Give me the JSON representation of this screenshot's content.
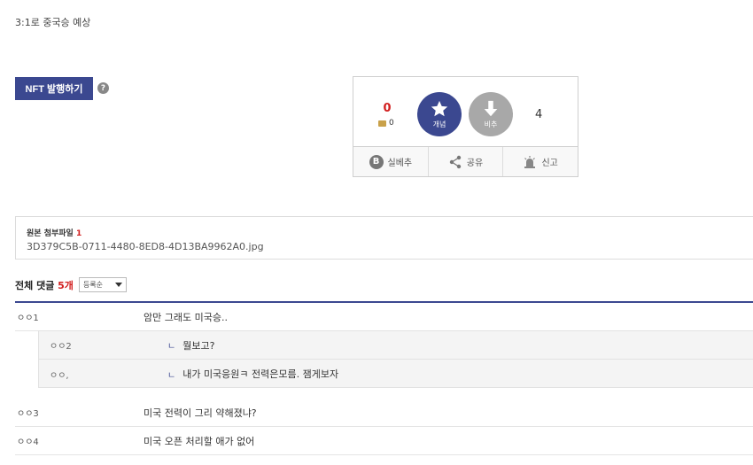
{
  "post": {
    "body_text": "3:1로 중국승 예상"
  },
  "nft": {
    "button_label": "NFT 발행하기",
    "help_glyph": "?"
  },
  "vote": {
    "up_count": "0",
    "sub_count": "0",
    "up_label": "개념",
    "down_label": "비추",
    "down_count": "4",
    "buttons": [
      {
        "label": "실베추",
        "icon": "b-badge-icon",
        "glyph": "B"
      },
      {
        "label": "공유",
        "icon": "share-icon"
      },
      {
        "label": "신고",
        "icon": "siren-icon"
      }
    ]
  },
  "attachment": {
    "title": "원본 첨부파일",
    "count": "1",
    "filename": "3D379C5B-0711-4480-8ED8-4D13BA9962A0.jpg"
  },
  "comments": {
    "title": "전체 댓글",
    "count": "5개",
    "sort_value": "등록순",
    "items": [
      {
        "author": "ㅇㅇ1",
        "content": "암만 그래도 미국승.."
      },
      {
        "author": "ㅇㅇ3",
        "content": "미국 전력이 그리 약해졌냐?"
      },
      {
        "author": "ㅇㅇ4",
        "content": "미국 오픈 처리할 애가 없어"
      }
    ],
    "replies": [
      {
        "author": "ㅇㅇ2",
        "content": "뭘보고?"
      },
      {
        "author": "ㅇㅇ,",
        "content": "내가 미국응원ㅋ 전력은모름. 잼게보자"
      }
    ],
    "reply_marker": "ㄴ"
  },
  "colors": {
    "accent": "#3b4890",
    "highlight": "#d21f1f",
    "neutral": "#a8a8a8"
  }
}
